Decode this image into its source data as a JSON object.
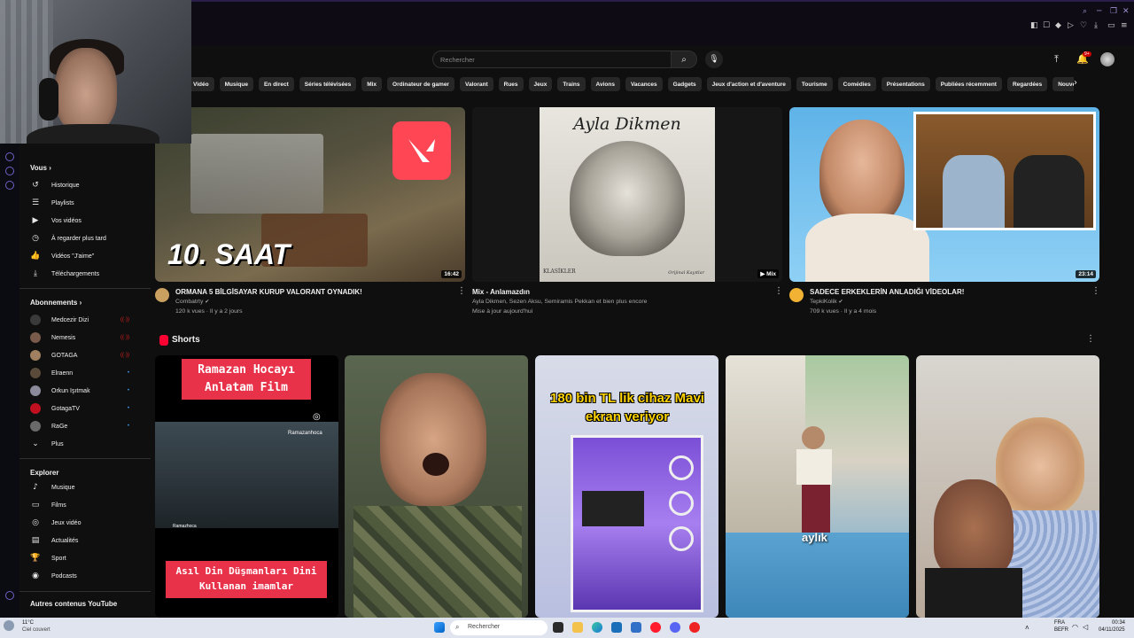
{
  "search": {
    "placeholder": "Rechercher"
  },
  "notifications": {
    "badge": "9+"
  },
  "chips": [
    "Vidéo",
    "Musique",
    "En direct",
    "Séries télévisées",
    "Mix",
    "Ordinateur de gamer",
    "Valorant",
    "Rues",
    "Jeux",
    "Trains",
    "Avions",
    "Vacances",
    "Gadgets",
    "Jeux d'action et d'aventure",
    "Tourisme",
    "Comédies",
    "Présentations",
    "Publiées récemment",
    "Regardées",
    "Nouve"
  ],
  "sidebar": {
    "you_heading": "Vous",
    "you_items": [
      {
        "label": "Historique",
        "icon": "history-icon"
      },
      {
        "label": "Playlists",
        "icon": "playlist-icon"
      },
      {
        "label": "Vos vidéos",
        "icon": "your-videos-icon"
      },
      {
        "label": "À regarder plus tard",
        "icon": "watch-later-icon"
      },
      {
        "label": "Vidéos \"J'aime\"",
        "icon": "like-icon"
      },
      {
        "label": "Téléchargements",
        "icon": "download-icon"
      }
    ],
    "subs_heading": "Abonnements",
    "subs_items": [
      {
        "label": "Medcezir Dizi",
        "color": "#3a3a3a"
      },
      {
        "label": "Nemesis",
        "color": "#7a5a4a"
      },
      {
        "label": "GOTAGA",
        "color": "#a08060"
      },
      {
        "label": "Elraenn",
        "color": "#5a4a3a"
      },
      {
        "label": "Orkun Işıtmak",
        "color": "#8a8a9a"
      },
      {
        "label": "GotagaTV",
        "color": "#c01020"
      },
      {
        "label": "RaGe",
        "color": "#6a6a6a"
      },
      {
        "label": "Plus",
        "color": ""
      }
    ],
    "explore_heading": "Explorer",
    "explore_items": [
      {
        "label": "Musique",
        "icon": "music-icon"
      },
      {
        "label": "Films",
        "icon": "films-icon"
      },
      {
        "label": "Jeux vidéo",
        "icon": "gaming-icon"
      },
      {
        "label": "Actualités",
        "icon": "news-icon"
      },
      {
        "label": "Sport",
        "icon": "sport-icon"
      },
      {
        "label": "Podcasts",
        "icon": "podcast-icon"
      }
    ],
    "more_heading": "Autres contenus YouTube"
  },
  "videos": [
    {
      "title": "ORMANA 5 BİLGİSAYAR KURUP VALORANT OYNADIK!",
      "channel": "Combatrty",
      "meta": "120 k vues · Il y a 2 jours",
      "duration": "16:42",
      "overlay": "10. SAAT"
    },
    {
      "title": "Mix - Anlamazdın",
      "channel": "Ayla Dikmen, Sezen Aksu, Semiramis Pekkan et bien plus encore",
      "meta": "Mise à jour aujourd'hui",
      "duration": "Mix",
      "overlay": "Ayla Dikmen",
      "sub_overlay_left": "KLASİKLER",
      "sub_overlay_right": "Orijinal Kayıtlar"
    },
    {
      "title": "SADECE ERKEKLERİN ANLADIĞI VİDEOLAR!",
      "channel": "TepkiKolik",
      "meta": "709 k vues · Il y a 4 mois",
      "duration": "23:14",
      "overlay": ""
    }
  ],
  "shorts": {
    "heading": "Shorts",
    "items": [
      {
        "top_text": "Ramazan Hocayı Anlatam Film",
        "bottom_text": "Asıl Din Düşmanları Dini Kullanan imamlar",
        "tag": "Ramazanhoca",
        "tag2": "Ramazhoca"
      },
      {
        "top_text": ""
      },
      {
        "top_text": "180 bin TL lik cihaz Mavi ekran veriyor"
      },
      {
        "top_text": "aylık"
      },
      {
        "top_text": ""
      }
    ]
  },
  "taskbar": {
    "weather_temp": "11°C",
    "weather_desc": "Ciel couvert",
    "search": "Rechercher",
    "lang1": "FRA",
    "lang2": "BEFR",
    "time": "00:34",
    "date": "04/11/2025"
  }
}
